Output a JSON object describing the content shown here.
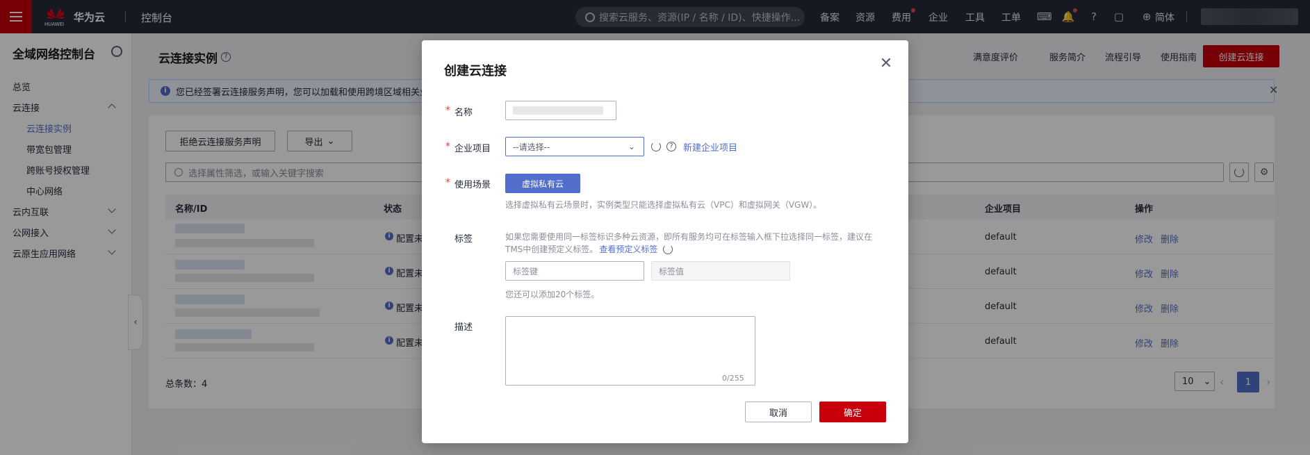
{
  "topbar": {
    "brand": "华为云",
    "console": "控制台",
    "search_placeholder": "搜索云服务、资源(IP / 名称 / ID)、快捷操作...",
    "nav": [
      "备案",
      "资源",
      "费用",
      "企业",
      "工具",
      "工单"
    ],
    "lang": "简体"
  },
  "sidebar": {
    "title": "全域网络控制台",
    "items": {
      "overview": "总览",
      "cloud_connect": "云连接",
      "sub": [
        "云连接实例",
        "带宽包管理",
        "跨账号授权管理",
        "中心网络"
      ],
      "intranet": "云内互联",
      "public": "公网接入",
      "native": "云原生应用网络"
    }
  },
  "main": {
    "title": "云连接实例",
    "header_links": [
      "满意度评价",
      "服务简介",
      "流程引导",
      "使用指南"
    ],
    "create_button": "创建云连接",
    "notice": "您已经签署云连接服务声明，您可以加载和使用跨境区域相关业务。",
    "refuse_button": "拒绝云连接服务声明",
    "export_button": "导出",
    "filter_placeholder": "选择属性筛选，或输入关键字搜索",
    "columns": {
      "name": "名称/ID",
      "status": "状态",
      "project": "企业项目",
      "ops": "操作"
    },
    "rows": [
      {
        "status": "配置未",
        "project": "default",
        "edit": "修改",
        "delete": "删除"
      },
      {
        "status": "配置未",
        "project": "default",
        "edit": "修改",
        "delete": "删除"
      },
      {
        "status": "配置未",
        "project": "default",
        "edit": "修改",
        "delete": "删除"
      },
      {
        "status": "配置未",
        "project": "default",
        "edit": "修改",
        "delete": "删除"
      }
    ],
    "total": "总条数：4",
    "page_size": "10",
    "current_page": "1"
  },
  "modal": {
    "title": "创建云连接",
    "name_label": "名称",
    "project_label": "企业项目",
    "project_placeholder": "--请选择--",
    "new_project_link": "新建企业项目",
    "scene_label": "使用场景",
    "scene_button": "虚拟私有云",
    "scene_hint": "选择虚拟私有云场景时，实例类型只能选择虚拟私有云（VPC）和虚拟网关（VGW）。",
    "tag_label": "标签",
    "tag_hint_1": "如果您需要使用同一标签标识多种云资源，即所有服务均可在标签输入框下拉选择同一标签，建议在",
    "tag_hint_2": "TMS中创建预定义标签。",
    "tag_link": "查看预定义标签",
    "tag_key_placeholder": "标签键",
    "tag_value_placeholder": "标签值",
    "tag_remaining": "您还可以添加20个标签。",
    "desc_label": "描述",
    "desc_counter": "0/255",
    "cancel": "取消",
    "confirm": "确定"
  }
}
